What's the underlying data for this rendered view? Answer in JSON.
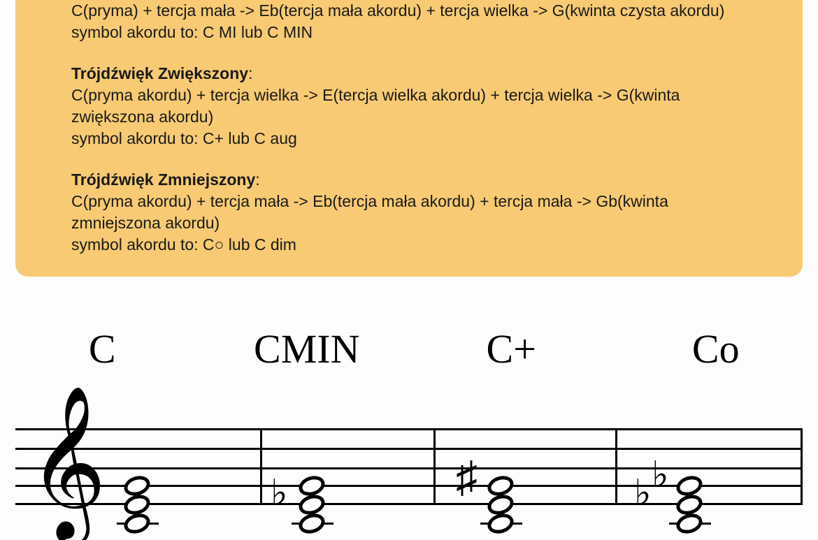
{
  "triad_minor": {
    "partial_line": "C(pryma) + tercja mała -> Eb(tercja mała akordu) + tercja wielka -> G(kwinta czysta akordu)",
    "symbol_line": "symbol akordu to: C MI lub C MIN"
  },
  "triad_augmented": {
    "title": "Trójdźwięk Zwiększony",
    "body": "C(pryma akordu) + tercja wielka -> E(tercja wielka akordu) + tercja wielka -> G(kwinta zwiększona akordu)",
    "symbol_line": "symbol akordu to: C+ lub C aug"
  },
  "triad_diminished": {
    "title": "Trójdźwięk Zmniejszony",
    "body": "C(pryma akordu) + tercja mała -> Eb(tercja mała akordu) + tercja mała -> Gb(kwinta zmniejszona akordu)",
    "symbol_line": "symbol akordu to: C○ lub C dim"
  },
  "chord_labels": {
    "major": "C",
    "minor": "CMIN",
    "augmented": "C+",
    "diminished": "Co"
  }
}
